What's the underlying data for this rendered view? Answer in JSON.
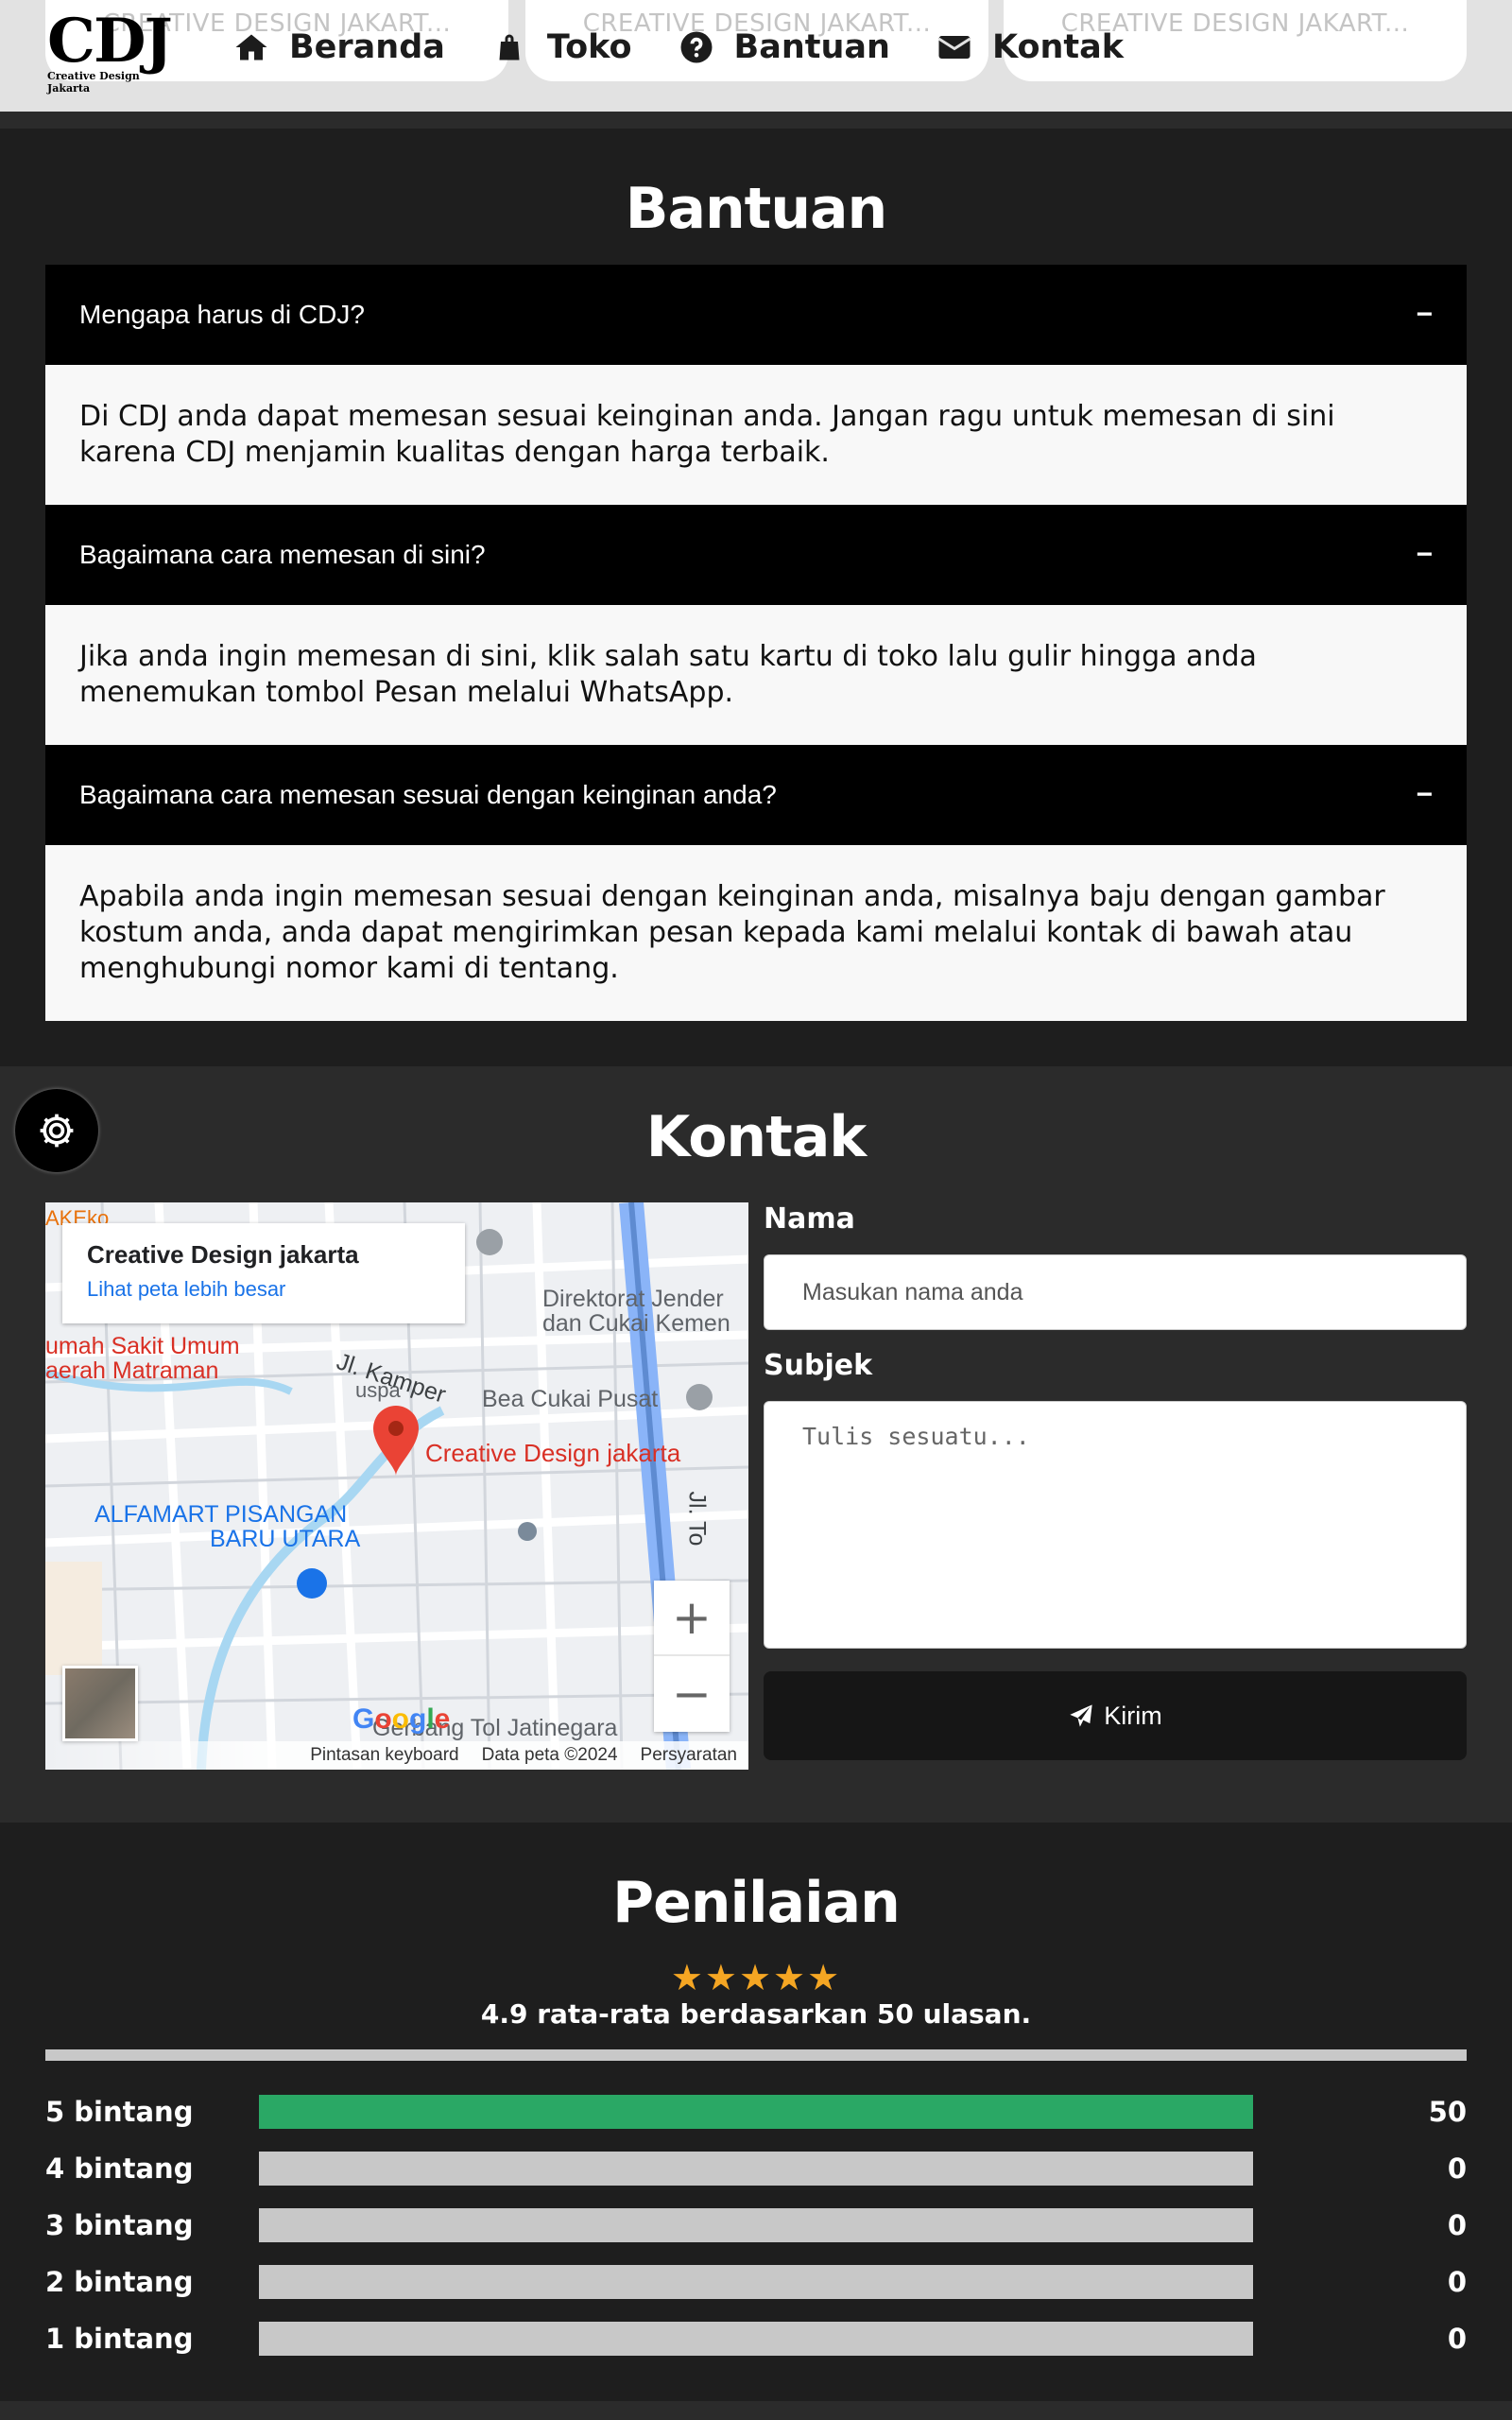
{
  "top_cards": [
    "CREATIVE DESIGN JAKART...",
    "CREATIVE DESIGN JAKART...",
    "CREATIVE DESIGN JAKART..."
  ],
  "logo": {
    "main": "CDJ",
    "sub": "Creative Design Jakarta"
  },
  "nav": [
    {
      "label": "Beranda",
      "icon": "home-icon"
    },
    {
      "label": "Toko",
      "icon": "shopping-bag-icon"
    },
    {
      "label": "Bantuan",
      "icon": "question-circle-icon"
    },
    {
      "label": "Kontak",
      "icon": "envelope-icon"
    }
  ],
  "faq": {
    "title": "Bantuan",
    "items": [
      {
        "question": "Mengapa harus di CDJ?",
        "toggle": "−",
        "answer": "Di CDJ anda dapat memesan sesuai keinginan anda. Jangan ragu untuk memesan di sini karena CDJ menjamin kualitas dengan harga terbaik."
      },
      {
        "question": "Bagaimana cara memesan di sini?",
        "toggle": "−",
        "answer": "Jika anda ingin memesan di sini, klik salah satu kartu di toko lalu gulir hingga anda menemukan tombol Pesan melalui WhatsApp."
      },
      {
        "question": "Bagaimana cara memesan sesuai dengan keinginan anda?",
        "toggle": "−",
        "answer": "Apabila anda ingin memesan sesuai dengan keinginan anda, misalnya baju dengan gambar kostum anda, anda dapat mengirimkan pesan kepada kami melalui kontak di bawah atau menghubungi nomor kami di tentang."
      }
    ]
  },
  "contact": {
    "title": "Kontak",
    "map": {
      "place_name": "Creative Design jakarta",
      "larger_map_link": "Lihat peta lebih besar",
      "pin_label": "Creative Design jakarta",
      "labels": [
        "Direktorat Jender",
        "dan Cukai Kemen",
        "umah Sakit Umum",
        "aerah Matraman",
        "Jl. Kamper",
        "Bea Cukai Pusat",
        "ALFAMART PISANGAN",
        "BARU UTARA",
        "Gerbang Tol Jatinegara",
        "Jl. To",
        "AKEko",
        "uspa"
      ],
      "zoom_in": "+",
      "zoom_out": "−",
      "google": "Google",
      "footer": [
        "Pintasan keyboard",
        "Data peta ©2024",
        "Persyaratan"
      ]
    },
    "form": {
      "name_label": "Nama",
      "name_placeholder": "Masukan nama anda",
      "subject_label": "Subjek",
      "subject_placeholder": "Tulis sesuatu...",
      "submit_label": "Kirim"
    }
  },
  "rating": {
    "title": "Penilaian",
    "stars": "★★★★★",
    "summary": "4.9 rata-rata berdasarkan 50 ulasan.",
    "bars": [
      {
        "label": "5 bintang",
        "count": "50",
        "fraction": 1.0
      },
      {
        "label": "4 bintang",
        "count": "0",
        "fraction": 0
      },
      {
        "label": "3 bintang",
        "count": "0",
        "fraction": 0
      },
      {
        "label": "2 bintang",
        "count": "0",
        "fraction": 0
      },
      {
        "label": "1 bintang",
        "count": "0",
        "fraction": 0
      }
    ]
  },
  "colors": {
    "accent_green": "#2aa865",
    "star": "#f5a623",
    "dark_bg": "#1e1e1e",
    "contact_bg": "#2b2b2b"
  }
}
